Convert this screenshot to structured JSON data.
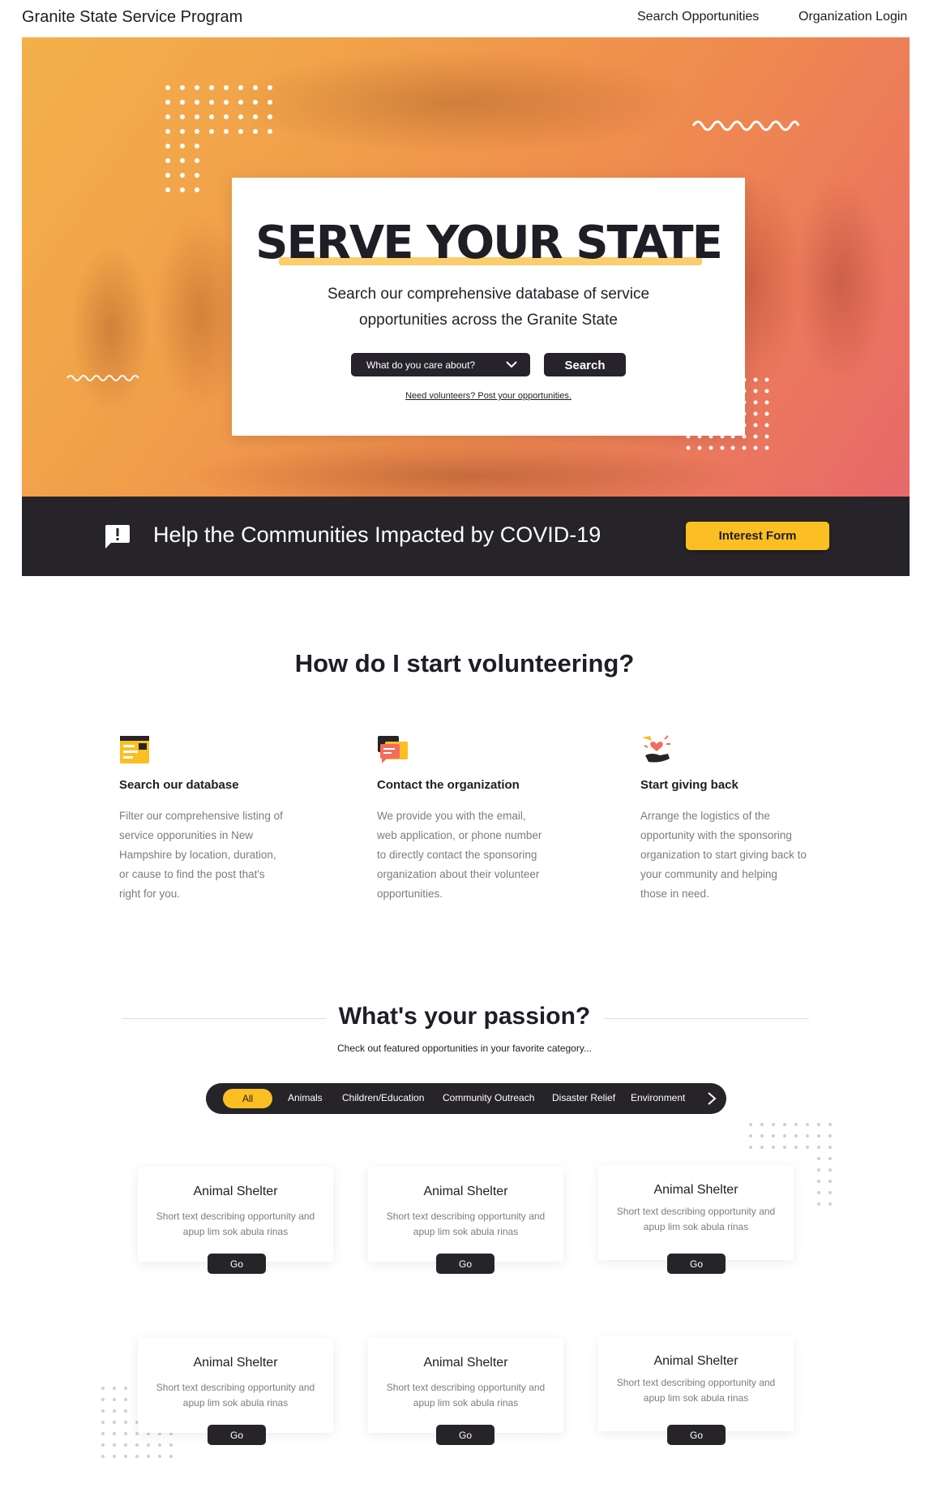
{
  "nav": {
    "brand": "Granite State Service Program",
    "search_link": "Search Opportunities",
    "login_link": "Organization Login"
  },
  "hero": {
    "title": "SERVE YOUR STATE",
    "subtitle": "Search our comprehensive database of service opportunities across the Granite State",
    "dropdown_value": "What do you care about?",
    "search_label": "Search",
    "post_link": "Need volunteers? Post your opportunities."
  },
  "covid": {
    "text": "Help the Communities Impacted by COVID-19",
    "button": "Interest Form",
    "icon": "alert-message-icon"
  },
  "how": {
    "title": "How do I start volunteering?",
    "steps": [
      {
        "icon": "database-icon",
        "title": "Search our database",
        "desc": "Filter our comprehensive listing of service opporunities in New Hampshire by location, duration, or cause to find the post that's right for you."
      },
      {
        "icon": "chat-bubbles-icon",
        "title": "Contact the organization",
        "desc": "We provide you with the email, web application, or phone number to directly contact the sponsoring organization about their volunteer opportunities."
      },
      {
        "icon": "giving-hand-icon",
        "title": "Start giving back",
        "desc": "Arrange the logistics of the opportunity with the sponsoring organization to start giving back to your community and helping those in need."
      }
    ]
  },
  "passion": {
    "title": "What's your passion?",
    "subtitle": "Check out featured opportunities in your favorite category...",
    "filters": [
      "All",
      "Animals",
      "Children/Education",
      "Community Outreach",
      "Disaster Relief",
      "Environment"
    ],
    "active_filter": "All",
    "cards": [
      {
        "title": "Animal Shelter",
        "desc": "Short text describing opportunity and apup lim sok abula rinas",
        "button": "Go"
      },
      {
        "title": "Animal Shelter",
        "desc": "Short text describing opportunity and apup lim sok abula rinas",
        "button": "Go"
      },
      {
        "title": "Animal Shelter",
        "desc": "Short text describing opportunity and apup lim sok abula rinas",
        "button": "Go"
      },
      {
        "title": "Animal Shelter",
        "desc": "Short text describing opportunity and apup lim sok abula rinas",
        "button": "Go"
      },
      {
        "title": "Animal Shelter",
        "desc": "Short text describing opportunity and apup lim sok abula rinas",
        "button": "Go"
      },
      {
        "title": "Animal Shelter",
        "desc": "Short text describing opportunity and apup lim sok abula rinas",
        "button": "Go"
      }
    ]
  },
  "colors": {
    "accent": "#fbbf24",
    "dark": "#262428",
    "hero_start": "#f3b14a",
    "hero_end": "#e8686a"
  }
}
